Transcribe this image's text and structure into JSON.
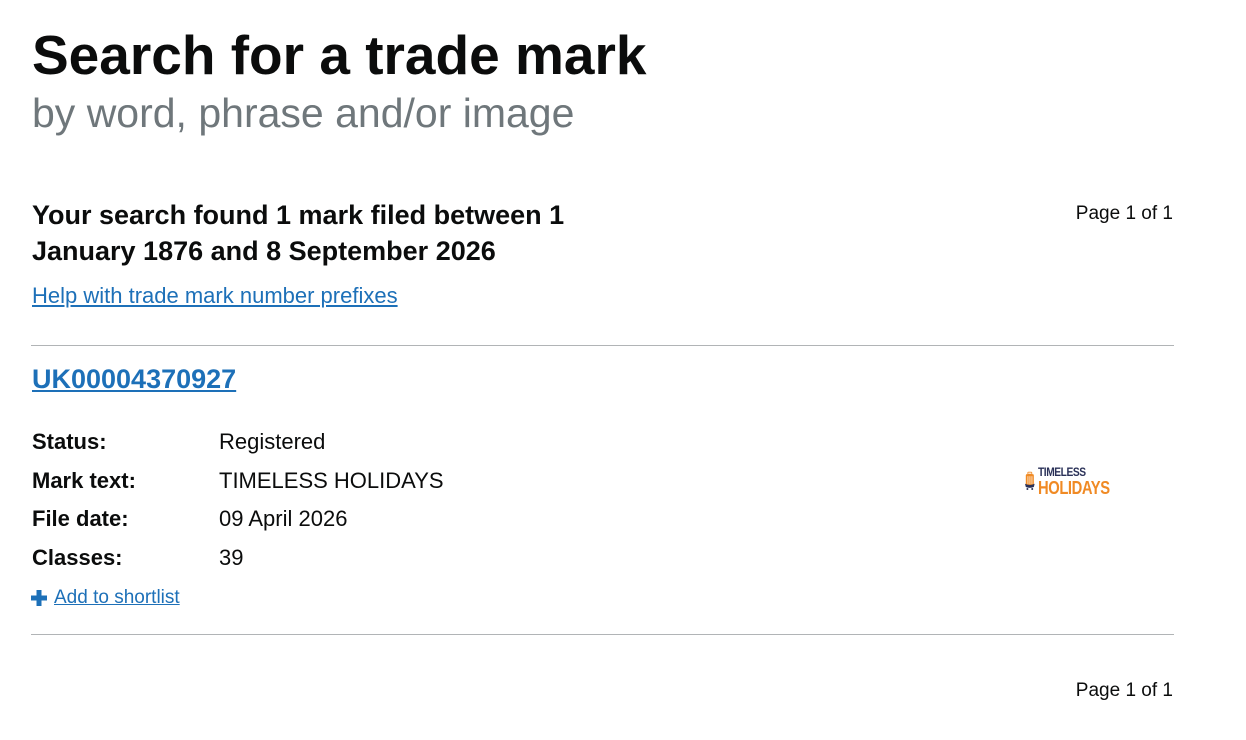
{
  "header": {
    "title": "Search for a trade mark",
    "subtitle": "by word, phrase and/or image"
  },
  "results": {
    "summary": "Your search found 1 mark filed between 1 January 1876 and 8 September 2026",
    "page_indicator_top": "Page 1 of 1",
    "page_indicator_bottom": "Page 1 of 1",
    "help_link": "Help with trade mark number prefixes"
  },
  "mark": {
    "number": "UK00004370927",
    "details": [
      {
        "label": "Status:",
        "value": "Registered"
      },
      {
        "label": "Mark text:",
        "value": "TIMELESS HOLIDAYS"
      },
      {
        "label": "File date:",
        "value": "09 April 2026"
      },
      {
        "label": "Classes:",
        "value": "39"
      }
    ],
    "shortlist_label": "Add to shortlist",
    "image": {
      "line1": "TIMELESS",
      "line2": "HOLIDAYS",
      "colors": {
        "navy": "#2a3158",
        "orange": "#f08a24"
      }
    }
  },
  "colors": {
    "link": "#1d70b8",
    "text": "#0b0c0c",
    "secondary_text": "#6f777b",
    "divider": "#b1b4b6"
  }
}
